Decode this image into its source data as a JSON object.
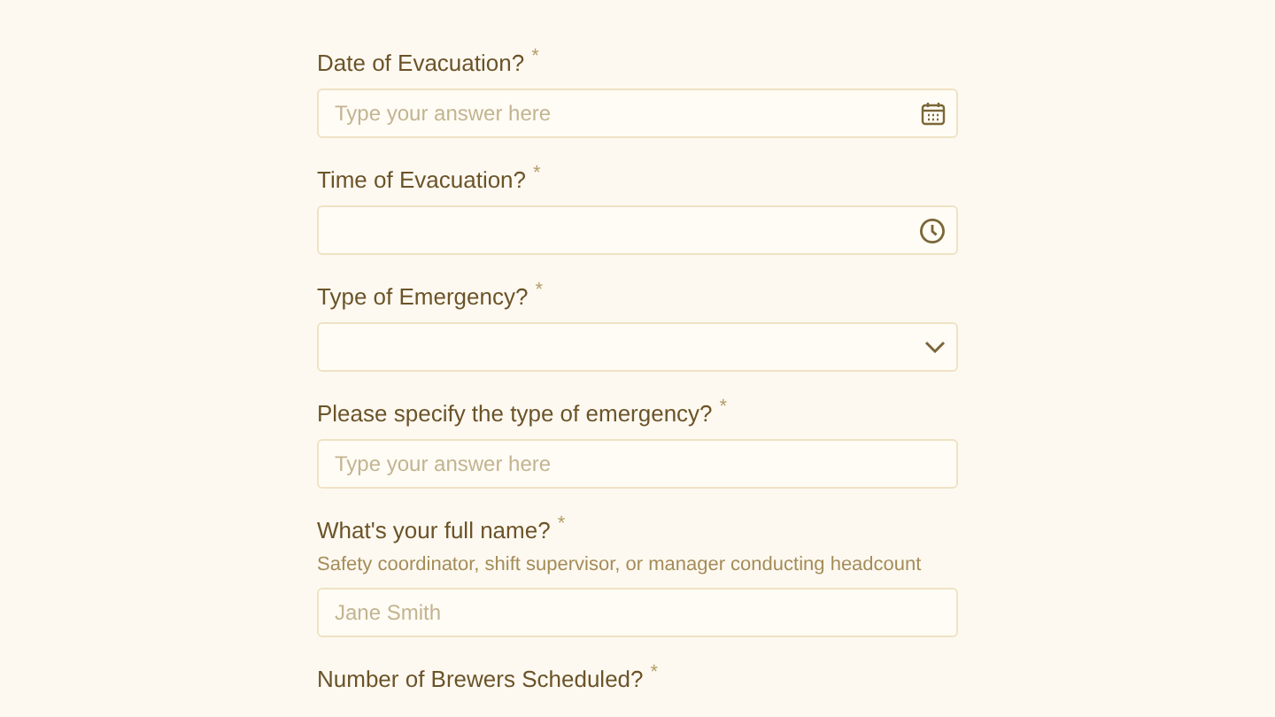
{
  "questions": [
    {
      "label": "Date of Evacuation?",
      "required_mark": "*",
      "field": {
        "kind": "date",
        "placeholder": "Type your answer here"
      }
    },
    {
      "label": "Time of Evacuation?",
      "required_mark": "*",
      "field": {
        "kind": "time"
      }
    },
    {
      "label": "Type of Emergency?",
      "required_mark": "*",
      "field": {
        "kind": "select"
      }
    },
    {
      "label": "Please specify the type of emergency?",
      "required_mark": "*",
      "field": {
        "kind": "text",
        "placeholder": "Type your answer here"
      }
    },
    {
      "label": "What's your full name?",
      "required_mark": "*",
      "description": "Safety coordinator, shift supervisor, or manager conducting headcount",
      "field": {
        "kind": "text",
        "placeholder": "Jane Smith"
      }
    },
    {
      "label": "Number of Brewers Scheduled?",
      "required_mark": "*"
    }
  ]
}
